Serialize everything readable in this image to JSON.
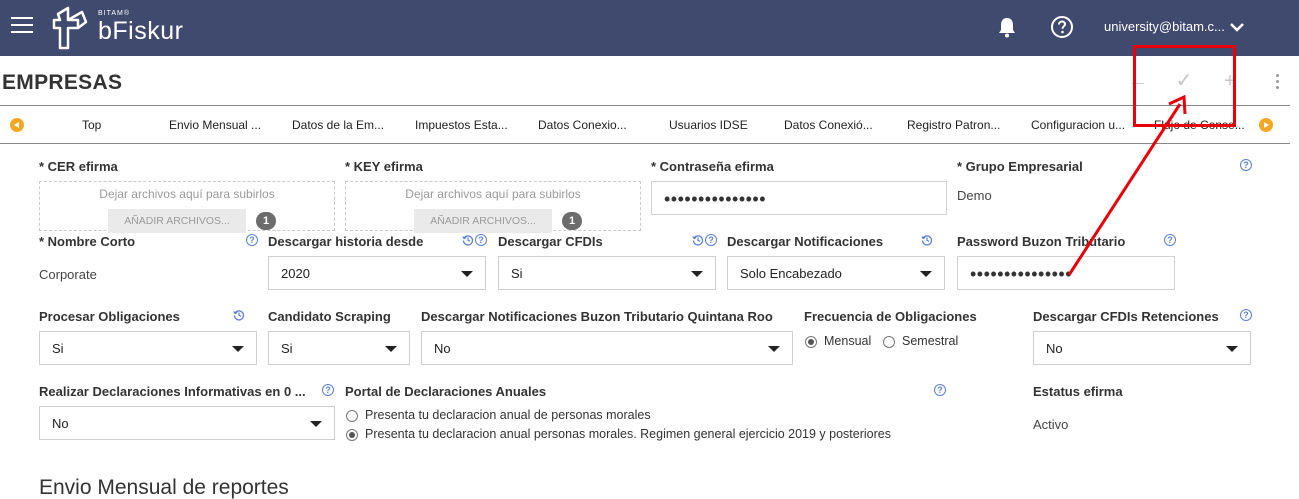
{
  "header": {
    "logo_small": "BITAM®",
    "logo_name": "bFiskur",
    "user": "university@bitam.c..."
  },
  "page": {
    "title": "EMPRESAS",
    "actions": {
      "back": "←",
      "save": "✓",
      "add": "+"
    }
  },
  "tabs": [
    "Top",
    "Envio Mensual ...",
    "Datos de la Em...",
    "Impuestos Esta...",
    "Datos Conexio...",
    "Usuarios IDSE",
    "Datos Conexió...",
    "Registro Patron...",
    "Configuracion u...",
    "Flujo de Conse..."
  ],
  "form": {
    "cer": {
      "label": "* CER efirma",
      "drop_text": "Dejar archivos aquí para subirlos",
      "button": "AÑADIR ARCHIVOS...",
      "count": "1"
    },
    "key": {
      "label": "* KEY efirma",
      "drop_text": "Dejar archivos aquí para subirlos",
      "button": "AÑADIR ARCHIVOS...",
      "count": "1"
    },
    "contrasena": {
      "label": "* Contraseña efirma",
      "value": "•••••••••••••••"
    },
    "grupo": {
      "label": "* Grupo Empresarial",
      "value": "Demo"
    },
    "nombre_corto": {
      "label": "* Nombre Corto",
      "value": "Corporate"
    },
    "historia": {
      "label": "Descargar historia desde",
      "value": "2020"
    },
    "cfdis": {
      "label": "Descargar CFDIs",
      "value": "Si"
    },
    "notificaciones": {
      "label": "Descargar Notificaciones",
      "value": "Solo Encabezado"
    },
    "password_buzon": {
      "label": "Password Buzon Tributario",
      "value": "•••••••••••••••"
    },
    "procesar": {
      "label": "Procesar Obligaciones",
      "value": "Si"
    },
    "scraping": {
      "label": "Candidato Scraping",
      "value": "Si"
    },
    "buzon_qroo": {
      "label": "Descargar Notificaciones Buzon Tributario Quintana Roo",
      "value": "No"
    },
    "frecuencia": {
      "label": "Frecuencia de Obligaciones",
      "options": [
        "Mensual",
        "Semestral"
      ],
      "selected": "Mensual"
    },
    "retenciones": {
      "label": "Descargar CFDIs Retenciones",
      "value": "No"
    },
    "informativas": {
      "label": "Realizar Declaraciones Informativas en 0 ...",
      "value": "No"
    },
    "portal": {
      "label": "Portal de Declaraciones Anuales",
      "options": [
        "Presenta tu declaracion anual de personas morales",
        "Presenta tu declaracion anual personas morales. Regimen general ejercicio 2019 y posteriores"
      ],
      "selected": "Presenta tu declaracion anual personas morales. Regimen general ejercicio 2019 y posteriores"
    },
    "estatus": {
      "label": "Estatus efirma",
      "value": "Activo"
    }
  },
  "section": {
    "heading": "Envio Mensual de reportes"
  },
  "icons": {
    "help": "?",
    "history": "history-icon",
    "menu": "menu-icon",
    "bell": "bell-icon",
    "chevron": "chevron-down-icon"
  },
  "colors": {
    "header_bg": "#3f4a6e",
    "accent_help": "#5b7fd3",
    "tab_arrow": "#f5a623",
    "highlight": "#e8000b"
  }
}
